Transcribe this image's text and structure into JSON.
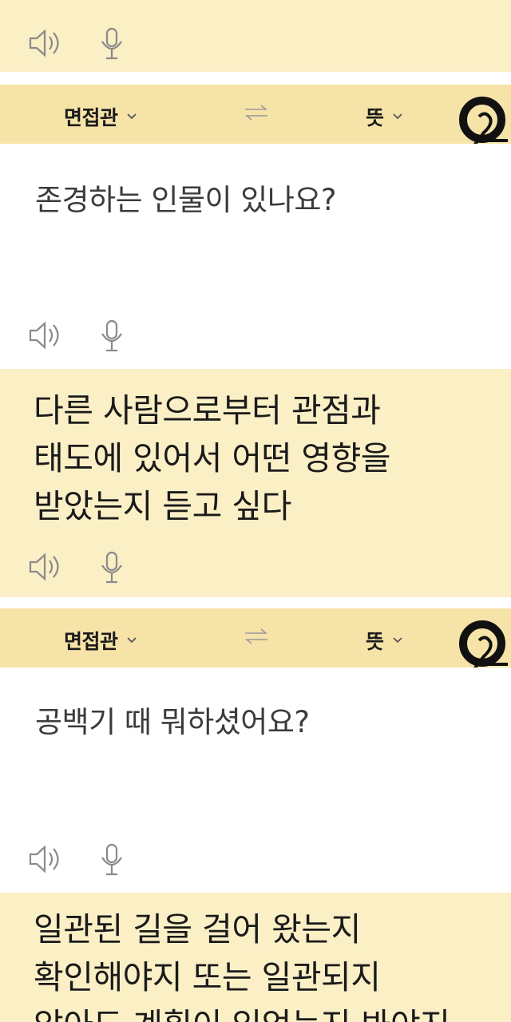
{
  "panels": [
    {
      "header": {
        "source_lang": "면접관",
        "target_lang": "뜻"
      },
      "source_text": "존경하는 인물이 있나요?",
      "target_lines": [
        "다른 사람으로부터 관점과",
        "태도에 있어서 어떤 영향을",
        "받았는지 듣고 싶다"
      ]
    },
    {
      "header": {
        "source_lang": "면접관",
        "target_lang": "뜻"
      },
      "source_text": "공백기 때 뭐하셨어요?",
      "target_lines": [
        "일관된 길을 걸어 왔는지",
        "확인해야지 또는 일관되지",
        "않아도 계획이 있었는지 봐야지"
      ]
    }
  ],
  "icons": {
    "speaker": "speaker-icon",
    "mic": "microphone-icon",
    "swap": "swap-arrows-icon",
    "logo": "logo-q2-icon"
  },
  "colors": {
    "header": "#f6e3a8",
    "cream": "#fbefc6",
    "text": "#1a1a1a"
  }
}
